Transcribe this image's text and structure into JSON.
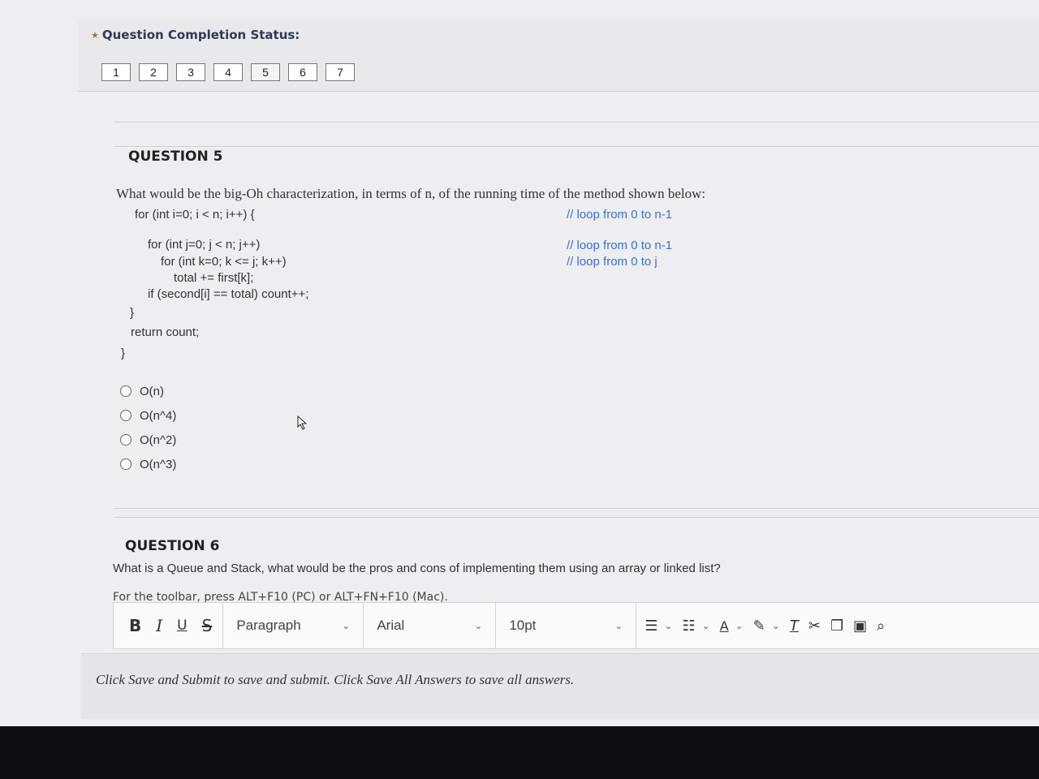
{
  "status": {
    "title": "Question Completion Status:",
    "question_numbers": [
      "1",
      "2",
      "3",
      "4",
      "5",
      "6",
      "7"
    ]
  },
  "question5": {
    "title": "QUESTION 5",
    "prompt": "What would be the big-Oh characterization, in terms of n, of the running time of the method shown below:",
    "code": {
      "line1": "for (int i=0; i < n; i++) {",
      "line2": "for (int j=0; j < n; j++)",
      "line3": "for (int k=0; k <= j; k++)",
      "line4": "total += first[k];",
      "line5": "if (second[i] == total) count++;",
      "line6": "}",
      "line7": "return count;",
      "line8": "}"
    },
    "comments": {
      "c1": "// loop from 0 to n-1",
      "c2": "// loop from 0 to n-1",
      "c3": "// loop from 0 to j"
    },
    "options": [
      "O(n)",
      "O(n^4)",
      "O(n^2)",
      "O(n^3)"
    ]
  },
  "question6": {
    "title": "QUESTION 6",
    "prompt": "What is a Queue and Stack, what would be the pros and cons of implementing them using an array or linked list?",
    "toolbar_hint": "For the toolbar, press ALT+F10 (PC) or ALT+FN+F10 (Mac).",
    "toolbar": {
      "bold": "B",
      "italic": "I",
      "underline": "U",
      "strike": "S",
      "paragraph": "Paragraph",
      "font": "Arial",
      "size": "10pt"
    }
  },
  "footer": {
    "text": "Click Save and Submit to save and submit. Click Save All Answers to save all answers."
  }
}
